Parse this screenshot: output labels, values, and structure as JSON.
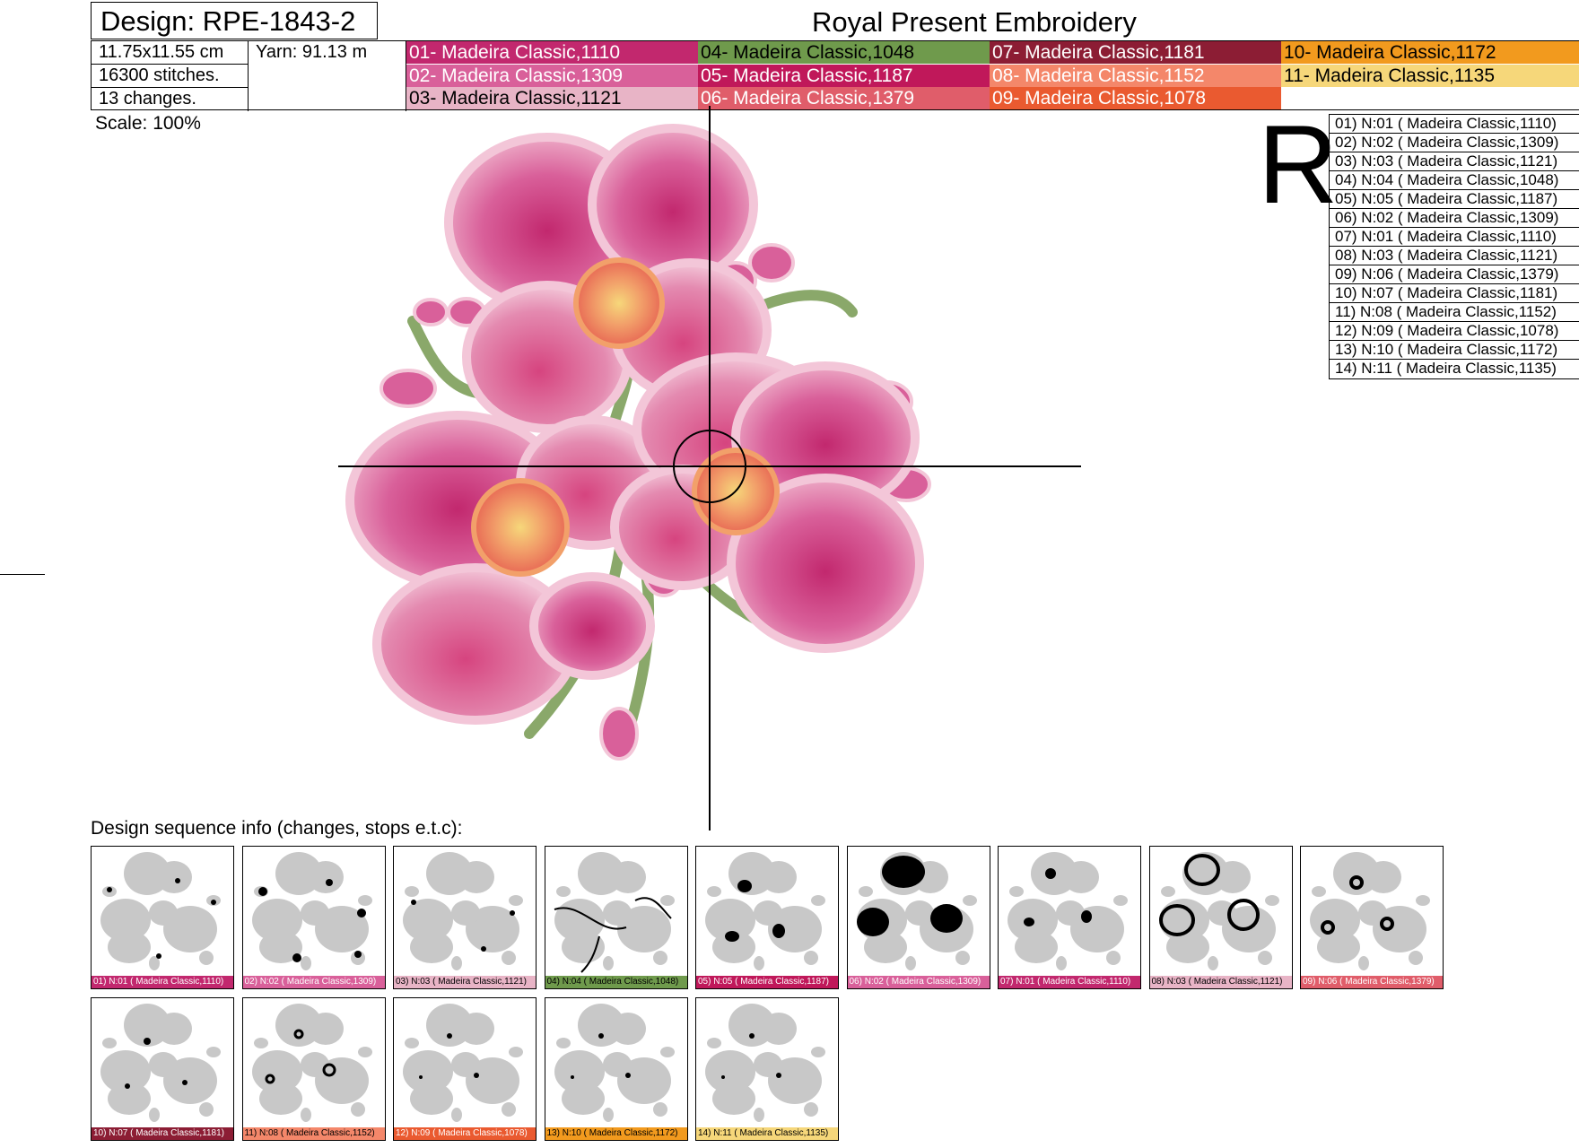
{
  "header": {
    "design_label": "Design: RPE-1843-2",
    "title": "Royal Present Embroidery",
    "size": "11.75x11.55 cm",
    "yarn": "Yarn: 91.13 m",
    "stitches": "16300 stitches.",
    "changes": "13 changes.",
    "scale": "Scale: 100%"
  },
  "palette": [
    {
      "label": "01- Madeira Classic,1110",
      "color": "#c2286e",
      "text_color": "#ffffff"
    },
    {
      "label": "02- Madeira Classic,1309",
      "color": "#d9609a",
      "text_color": "#ffffff"
    },
    {
      "label": "03- Madeira Classic,1121",
      "color": "#e8b4c6",
      "text_color": "#000000"
    },
    {
      "label": "04- Madeira Classic,1048",
      "color": "#6f9a4c",
      "text_color": "#000000"
    },
    {
      "label": "05- Madeira Classic,1187",
      "color": "#c0185a",
      "text_color": "#ffffff"
    },
    {
      "label": "06- Madeira Classic,1379",
      "color": "#e05d6a",
      "text_color": "#ffffff"
    },
    {
      "label": "07- Madeira Classic,1181",
      "color": "#8c1d34",
      "text_color": "#ffffff"
    },
    {
      "label": "08- Madeira Classic,1152",
      "color": "#f4876a",
      "text_color": "#ffffff"
    },
    {
      "label": "09- Madeira Classic,1078",
      "color": "#ea5a30",
      "text_color": "#ffffff"
    },
    {
      "label": "10- Madeira Classic,1172",
      "color": "#f29a1e",
      "text_color": "#000000"
    },
    {
      "label": "11- Madeira Classic,1135",
      "color": "#f6d77a",
      "text_color": "#000000"
    }
  ],
  "orientation_letter": "R",
  "sequence": [
    "01) N:01 ( Madeira Classic,1110)",
    "02) N:02 ( Madeira Classic,1309)",
    "03) N:03 ( Madeira Classic,1121)",
    "04) N:04 ( Madeira Classic,1048)",
    "05) N:05 ( Madeira Classic,1187)",
    "06) N:02 ( Madeira Classic,1309)",
    "07) N:01 ( Madeira Classic,1110)",
    "08) N:03 ( Madeira Classic,1121)",
    "09) N:06 ( Madeira Classic,1379)",
    "10) N:07 ( Madeira Classic,1181)",
    "11) N:08 ( Madeira Classic,1152)",
    "12) N:09 ( Madeira Classic,1078)",
    "13) N:10 ( Madeira Classic,1172)",
    "14) N:11 ( Madeira Classic,1135)"
  ],
  "sequence_caption": "Design sequence info (changes, stops e.t.c):",
  "thumbnails": [
    {
      "label": "01) N:01 ( Madeira Classic,1110)",
      "color": "#c2286e",
      "text_color": "#ffffff",
      "highlight": "stems-dots"
    },
    {
      "label": "02) N:02 ( Madeira Classic,1309)",
      "color": "#d9609a",
      "text_color": "#ffffff",
      "highlight": "buds"
    },
    {
      "label": "03) N:03 ( Madeira Classic,1121)",
      "color": "#e8b4c6",
      "text_color": "#000000",
      "highlight": "few-dots"
    },
    {
      "label": "04) N:04 ( Madeira Classic,1048)",
      "color": "#6f9a4c",
      "text_color": "#000000",
      "highlight": "stems"
    },
    {
      "label": "05) N:05 ( Madeira Classic,1187)",
      "color": "#c0185a",
      "text_color": "#ffffff",
      "highlight": "inner-petals"
    },
    {
      "label": "06) N:02 ( Madeira Classic,1309)",
      "color": "#d9609a",
      "text_color": "#ffffff",
      "highlight": "petals"
    },
    {
      "label": "07) N:01 ( Madeira Classic,1110)",
      "color": "#c2286e",
      "text_color": "#ffffff",
      "highlight": "accents"
    },
    {
      "label": "08) N:03 ( Madeira Classic,1121)",
      "color": "#e8b4c6",
      "text_color": "#000000",
      "highlight": "outlines"
    },
    {
      "label": "09) N:06 ( Madeira Classic,1379)",
      "color": "#e05d6a",
      "text_color": "#ffffff",
      "highlight": "centers"
    },
    {
      "label": "10) N:07 ( Madeira Classic,1181)",
      "color": "#8c1d34",
      "text_color": "#ffffff",
      "highlight": "small-centers"
    },
    {
      "label": "11) N:08 ( Madeira Classic,1152)",
      "color": "#f4876a",
      "text_color": "#000000",
      "highlight": "center-rings"
    },
    {
      "label": "12) N:09 ( Madeira Classic,1078)",
      "color": "#ea5a30",
      "text_color": "#ffffff",
      "highlight": "tiny-centers"
    },
    {
      "label": "13) N:10 ( Madeira Classic,1172)",
      "color": "#f29a1e",
      "text_color": "#000000",
      "highlight": "tiny-centers"
    },
    {
      "label": "14) N:11 ( Madeira Classic,1135)",
      "color": "#f6d77a",
      "text_color": "#000000",
      "highlight": "tiny-centers"
    }
  ]
}
